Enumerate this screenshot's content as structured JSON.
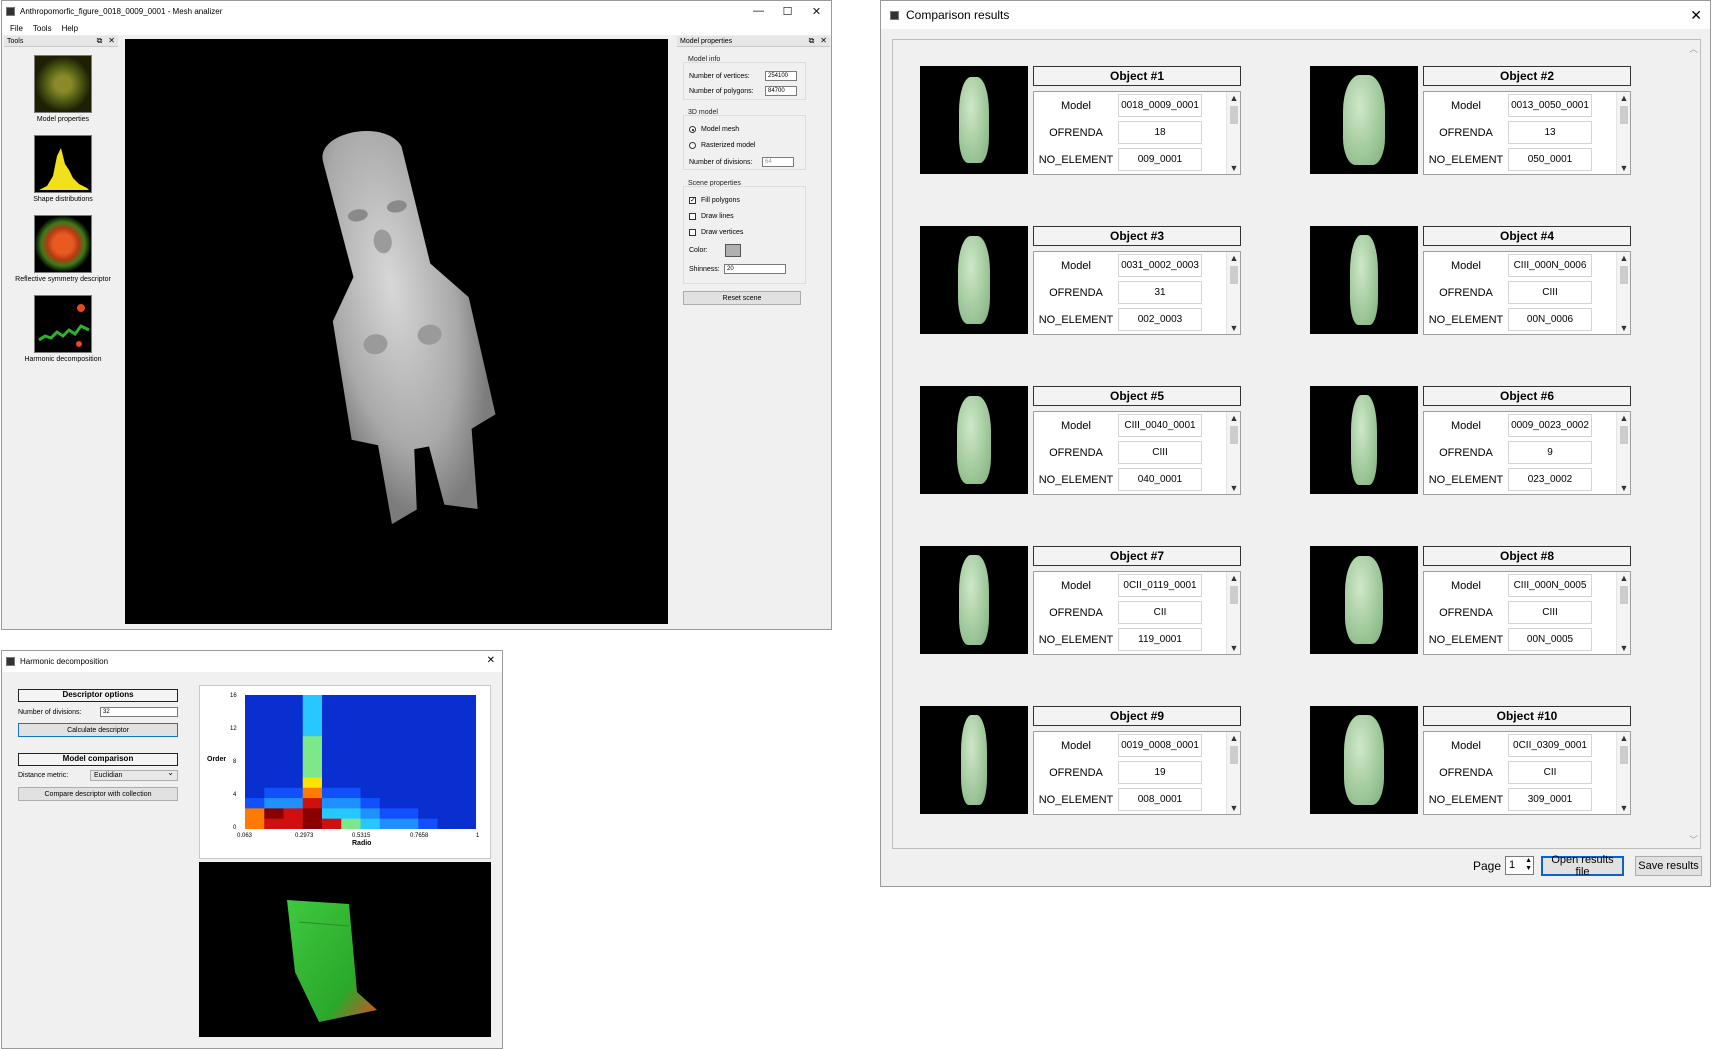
{
  "mesh_window": {
    "title": "Anthropomorfic_figure_0018_0009_0001 - Mesh analizer",
    "menu": [
      "File",
      "Tools",
      "Help"
    ],
    "window_buttons": [
      "—",
      "☐",
      "✕"
    ],
    "tools_dock": {
      "title": "Tools",
      "items": [
        {
          "label": "Model properties",
          "icon": "model-thumbnail"
        },
        {
          "label": "Shape distributions",
          "icon": "histogram-thumbnail"
        },
        {
          "label": "Reflective symmetry descriptor",
          "icon": "symmetry-thumbnail"
        },
        {
          "label": "Harmonic decomposition",
          "icon": "harmonic-thumbnail"
        }
      ]
    },
    "props_dock": {
      "title": "Model properties",
      "model_info": {
        "heading": "Model info",
        "vertices_label": "Number of vertices:",
        "vertices_value": "254100",
        "polygons_label": "Number of polygons:",
        "polygons_value": "84700"
      },
      "model_3d": {
        "heading": "3D model",
        "mesh_label": "Model mesh",
        "rasterized_label": "Rasterized model",
        "divisions_label": "Number of divisions:",
        "divisions_value": "64"
      },
      "scene": {
        "heading": "Scene properties",
        "fill_label": "Fill polygons",
        "lines_label": "Draw lines",
        "vertices_label": "Draw vertices",
        "color_label": "Color:",
        "color_value": "#b0b0b0",
        "shininess_label": "Shinness:",
        "shininess_value": "20",
        "reset_label": "Reset scene"
      }
    }
  },
  "harmonic_window": {
    "title": "Harmonic decomposition",
    "close": "✕",
    "descriptor_options": "Descriptor options",
    "divisions_label": "Number of divisions:",
    "divisions_value": "32",
    "calculate_label": "Calculate descriptor",
    "model_comparison": "Model comparison",
    "metric_label": "Distance metric:",
    "metric_value": "Euclidian",
    "compare_label": "Compare descriptor with collection",
    "chart": {
      "ylabel": "Order",
      "xlabel": "Radio",
      "yticks": [
        "16",
        "12",
        "8",
        "4",
        "0"
      ],
      "xticks": [
        "0.063",
        "0.2973",
        "0.5315",
        "0.7658",
        "1"
      ]
    }
  },
  "results_window": {
    "title": "Comparison results",
    "close": "✕",
    "row_keys": [
      "Model",
      "OFRENDA",
      "NO_ELEMENT"
    ],
    "objects": [
      {
        "title": "Object #1",
        "model": "0018_0009_0001",
        "ofrenda": "18",
        "element": "009_0001"
      },
      {
        "title": "Object #2",
        "model": "0013_0050_0001",
        "ofrenda": "13",
        "element": "050_0001"
      },
      {
        "title": "Object #3",
        "model": "0031_0002_0003",
        "ofrenda": "31",
        "element": "002_0003"
      },
      {
        "title": "Object #4",
        "model": "CIII_000N_0006",
        "ofrenda": "CIII",
        "element": "00N_0006"
      },
      {
        "title": "Object #5",
        "model": "CIII_0040_0001",
        "ofrenda": "CIII",
        "element": "040_0001"
      },
      {
        "title": "Object #6",
        "model": "0009_0023_0002",
        "ofrenda": "9",
        "element": "023_0002"
      },
      {
        "title": "Object #7",
        "model": "0CII_0119_0001",
        "ofrenda": "CII",
        "element": "119_0001"
      },
      {
        "title": "Object #8",
        "model": "CIII_000N_0005",
        "ofrenda": "CIII",
        "element": "00N_0005"
      },
      {
        "title": "Object #9",
        "model": "0019_0008_0001",
        "ofrenda": "19",
        "element": "008_0001"
      },
      {
        "title": "Object #10",
        "model": "0CII_0309_0001",
        "ofrenda": "CII",
        "element": "309_0001"
      }
    ],
    "page_label": "Page",
    "page_value": "1",
    "open_label": "Open results file",
    "save_label": "Save results"
  }
}
